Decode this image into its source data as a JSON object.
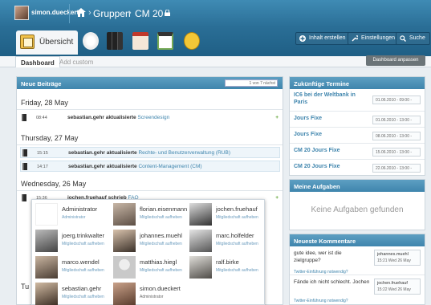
{
  "topbar": {
    "username": "simon.dueckert",
    "crumb_1": "Gruppen",
    "crumb_2": "CM 20",
    "separator": "›"
  },
  "iconbar": {
    "active_tab": "Übersicht",
    "icons": [
      "pencil-icon",
      "books-icon",
      "calendar-icon",
      "todo-icon",
      "user-icon"
    ],
    "buttons": [
      {
        "label": "Inhalt erstellen",
        "icon": "plus-icon"
      },
      {
        "label": "Einstellungen",
        "icon": "wrench-icon"
      },
      {
        "label": "Suche",
        "icon": "search-icon"
      }
    ]
  },
  "subtabs": {
    "dashboard": "Dashboard",
    "custom": "Add custom",
    "customize_button": "Dashboard anpassen"
  },
  "feed": {
    "title": "Neue Beiträge",
    "pager": "1 von 7  nächst",
    "days": [
      {
        "label": "Friday, 28 May"
      },
      {
        "label": "Thursday, 27 May"
      },
      {
        "label": "Wednesday, 26 May"
      },
      {
        "label": "Tu"
      }
    ],
    "entries": [
      {
        "time": "08:44",
        "user": "sebastian.gehr",
        "verb": "aktualisierte",
        "target": "Screendesign"
      },
      {
        "time": "15:15",
        "user": "sebastian.gehr",
        "verb": "aktualisierte",
        "target": "Rechte- und Benutzerverwaltung (RUB)"
      },
      {
        "time": "14:17",
        "user": "sebastian.gehr",
        "verb": "aktualisierte",
        "target": "Content-Management (CM)"
      },
      {
        "time": "15:36",
        "user": "jochen.fruehauf",
        "verb": "schrieb",
        "target": "FAQ"
      }
    ],
    "plus": "+"
  },
  "popup": {
    "users": [
      {
        "name": "Administrator",
        "role": "Administrator"
      },
      {
        "name": "florian.eisenmann",
        "role": "Mitgliedschaft aufheben"
      },
      {
        "name": "jochen.fruehauf",
        "role": "Mitgliedschaft aufheben"
      },
      {
        "name": "joerg.trinkwalter",
        "role": "Mitgliedschaft aufheben"
      },
      {
        "name": "johannes.muehl",
        "role": "Mitgliedschaft aufheben"
      },
      {
        "name": "marc.holfelder",
        "role": "Mitgliedschaft aufheben"
      },
      {
        "name": "marco.wendel",
        "role": "Mitgliedschaft aufheben"
      },
      {
        "name": "matthias.hiegl",
        "role": "Mitgliedschaft aufheben"
      },
      {
        "name": "ralf.birke",
        "role": "Mitgliedschaft aufheben"
      },
      {
        "name": "sebastian.gehr",
        "role": "Mitgliedschaft aufheben"
      },
      {
        "name": "simon.dueckert",
        "role": "Administrator"
      }
    ]
  },
  "termine": {
    "title": "Zukünftige Termine",
    "items": [
      {
        "title": "IC6 bei der Weltbank in Paris",
        "date": "01.06.2010 - 09:00 -"
      },
      {
        "title": "Jours Fixe",
        "date": "01.06.2010 - 13:00 -"
      },
      {
        "title": "Jours Fixe",
        "date": "08.06.2010 - 13:00 -"
      },
      {
        "title": "CM 20 Jours Fixe",
        "date": "15.06.2010 - 13:00 -"
      },
      {
        "title": "CM 20 Jours Fixe",
        "date": "22.06.2010 - 13:00 -"
      }
    ]
  },
  "aufgaben": {
    "title": "Meine Aufgaben",
    "empty": "Keine Aufgaben gefunden"
  },
  "kommentare": {
    "title": "Neueste Kommentare",
    "items": [
      {
        "text": "gute idee, wer ist die zielgruppe?",
        "link": "Twitter-Einführung notwendig?",
        "author": "johannes.muehl",
        "date": "15:21 Wed 26 May"
      },
      {
        "text": "Fände ich nicht schlecht. Jochen",
        "link": "Twitter-Einführung notwendig?",
        "author": "jochen.fruehauf",
        "date": "15:22 Wed 26 May"
      }
    ]
  }
}
